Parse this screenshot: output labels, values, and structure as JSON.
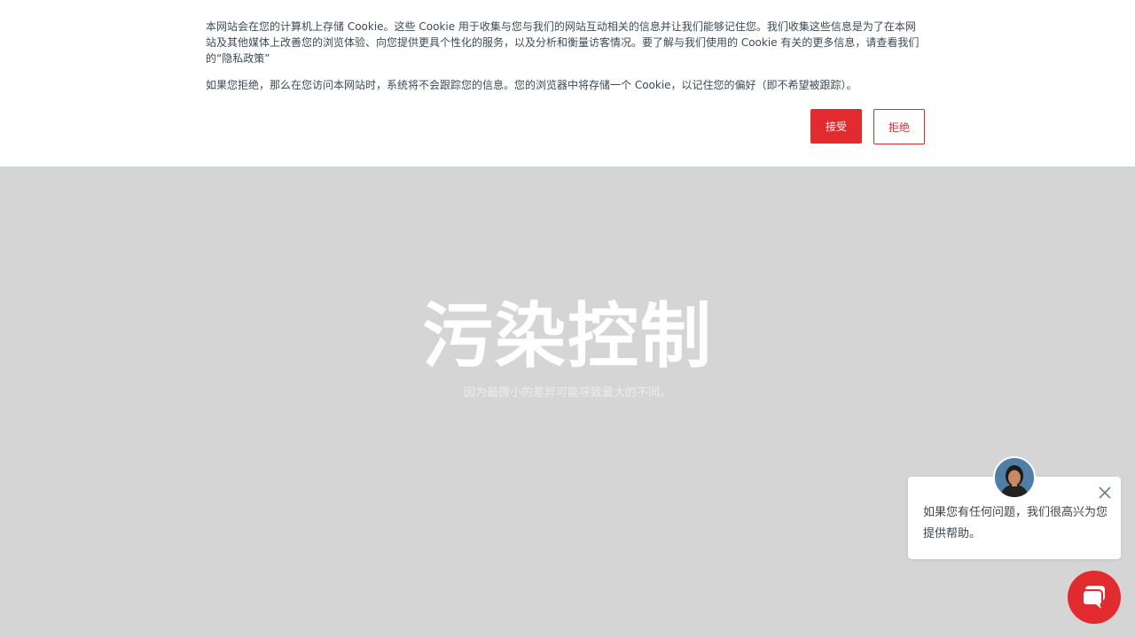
{
  "cookie_banner": {
    "paragraph1": "本网站会在您的计算机上存储 Cookie。这些 Cookie 用于收集与您与我们的网站互动相关的信息并让我们能够记住您。我们收集这些信息是为了在本网站及其他媒体上改善您的浏览体验、向您提供更具个性化的服务，以及分析和衡量访客情况。要了解与我们使用的 Cookie 有关的更多信息，请查看我们的“隐私政策”",
    "paragraph2": "如果您拒绝，那么在您访问本网站时，系统将不会跟踪您的信息。您的浏览器中将存储一个 Cookie，以记住您的偏好（即不希望被跟踪）。",
    "accept_label": "接受",
    "decline_label": "拒绝"
  },
  "hero": {
    "title": "污染控制",
    "subtitle": "因为最微小的差异可能导致最大的不同。"
  },
  "chat": {
    "message": "如果您有任何问题，我们很高兴为您提供帮助。",
    "close_icon": "close-icon",
    "launcher_icon": "chat-bubble-icon"
  },
  "colors": {
    "accent": "#e12b2f",
    "background": "#d5d5d5",
    "banner_text": "#3a4a58"
  }
}
